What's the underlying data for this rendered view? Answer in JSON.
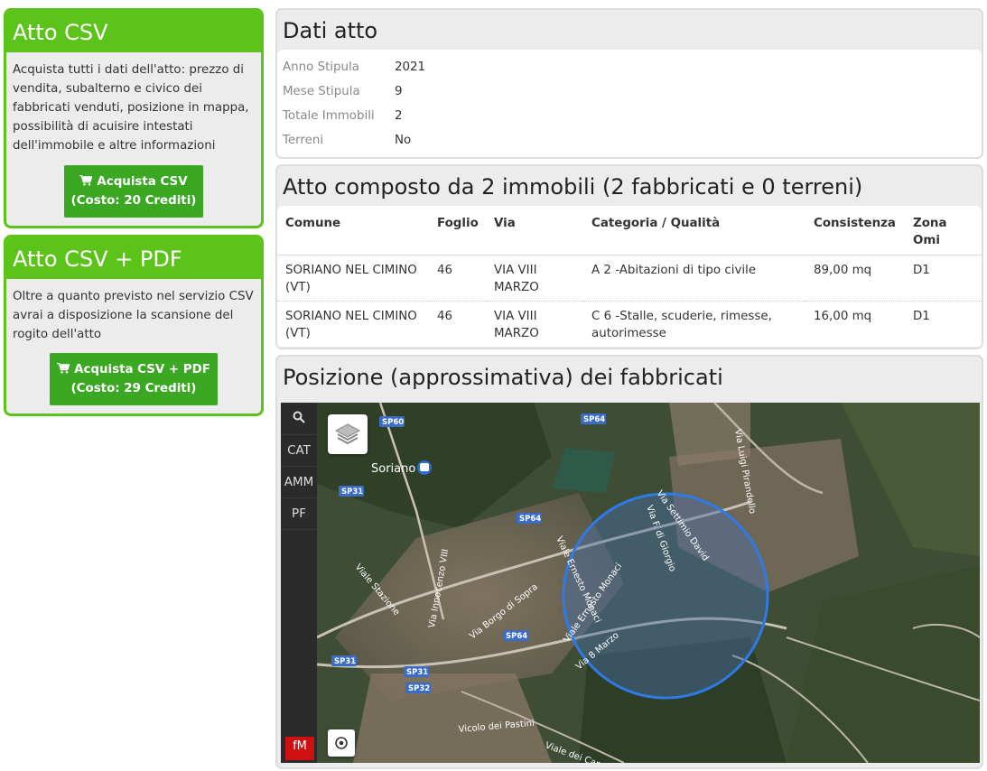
{
  "promos": [
    {
      "title": "Atto CSV",
      "description": "Acquista tutti i dati dell'atto: prezzo di vendita, subalterno e civico dei fabbricati venduti, posizione in mappa, possibilità di acuisire intestati dell'immobile e altre informazioni",
      "button_line1": "Acquista CSV",
      "button_line2": "(Costo: 20 Crediti)"
    },
    {
      "title": "Atto CSV + PDF",
      "description": "Oltre a quanto previsto nel servizio CSV avrai a disposizione la scansione del rogito dell'atto",
      "button_line1": "Acquista CSV + PDF",
      "button_line2": "(Costo: 29 Crediti)"
    }
  ],
  "dati_atto": {
    "title": "Dati atto",
    "rows": [
      {
        "label": "Anno Stipula",
        "value": "2021"
      },
      {
        "label": "Mese Stipula",
        "value": "9"
      },
      {
        "label": "Totale Immobili",
        "value": "2"
      },
      {
        "label": "Terreni",
        "value": "No"
      }
    ]
  },
  "immobili": {
    "title": "Atto composto da 2 immobili (2 fabbricati e 0 terreni)",
    "headers": [
      "Comune",
      "Foglio",
      "Via",
      "Categoria / Qualità",
      "Consistenza",
      "Zona Omi"
    ],
    "rows": [
      {
        "comune": "SORIANO NEL CIMINO (VT)",
        "foglio": "46",
        "via": "VIA VIII MARZO",
        "categoria": "A 2 -Abitazioni di tipo civile",
        "consistenza": "89,00 mq",
        "zona": "D1"
      },
      {
        "comune": "SORIANO NEL CIMINO (VT)",
        "foglio": "46",
        "via": "VIA VIII MARZO",
        "categoria": "C 6 -Stalle, scuderie, rimesse, autorimesse",
        "consistenza": "16,00 mq",
        "zona": "D1"
      }
    ]
  },
  "mappa": {
    "title": "Posizione (approssimativa) dei fabbricati",
    "tools": [
      "CAT",
      "AMM",
      "PF"
    ],
    "logo": "fM",
    "place_label": "Soriano",
    "road_labels": [
      "Via Luigi Pirandello",
      "Via Innocenzo VIII",
      "Viale Stazione",
      "Via Borgo di Sopra",
      "Viale Ernesto Monaci",
      "Via F. di Giorgio",
      "Via Settimio David",
      "Via 8 Marzo",
      "Vicolo dei Pastini",
      "Viale dei Capp"
    ],
    "sp_labels": [
      "SP60",
      "SP64",
      "SP31",
      "SP64",
      "SP64",
      "SP31",
      "SP31",
      "SP32"
    ]
  }
}
